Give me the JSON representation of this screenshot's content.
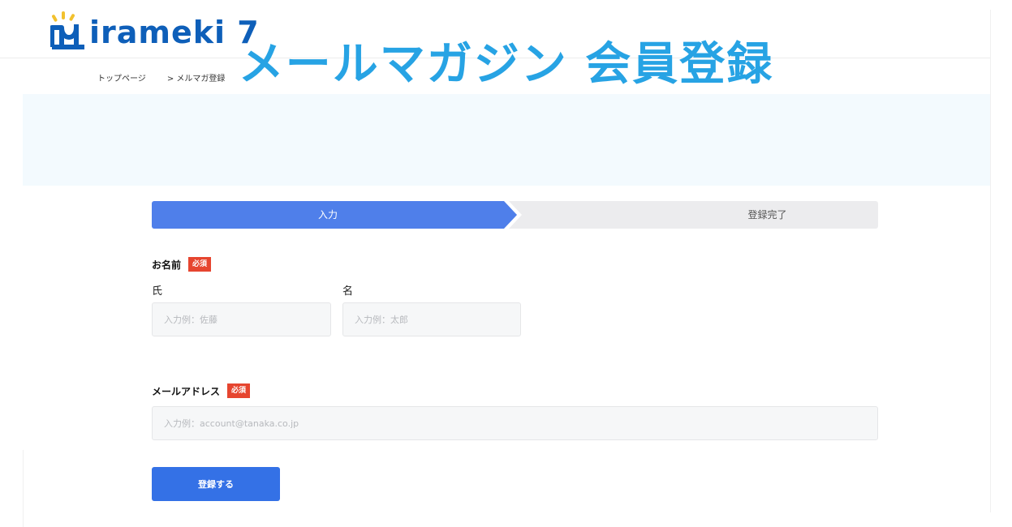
{
  "header": {
    "logo_text": "irameki 7"
  },
  "breadcrumb": {
    "home": "トップページ",
    "current": "> メルマガ登録"
  },
  "hero": {
    "title": "メールマガジン 会員登録"
  },
  "steps": [
    {
      "label": "入力"
    },
    {
      "label": "登録完了"
    }
  ],
  "form": {
    "name_label": "お名前",
    "required_badge": "必須",
    "last_name_label": "氏",
    "first_name_label": "名",
    "last_name_placeholder": "入力例：佐藤",
    "first_name_placeholder": "入力例：太郎",
    "email_label": "メールアドレス",
    "email_placeholder": "入力例：account@tanaka.co.jp",
    "submit_label": "登録する"
  },
  "colors": {
    "logo_blue": "#0e5fb9",
    "hero_title": "#27a3e4",
    "step_active": "#4f7fea",
    "badge_red": "#e6452f",
    "submit_blue": "#3471e6"
  }
}
